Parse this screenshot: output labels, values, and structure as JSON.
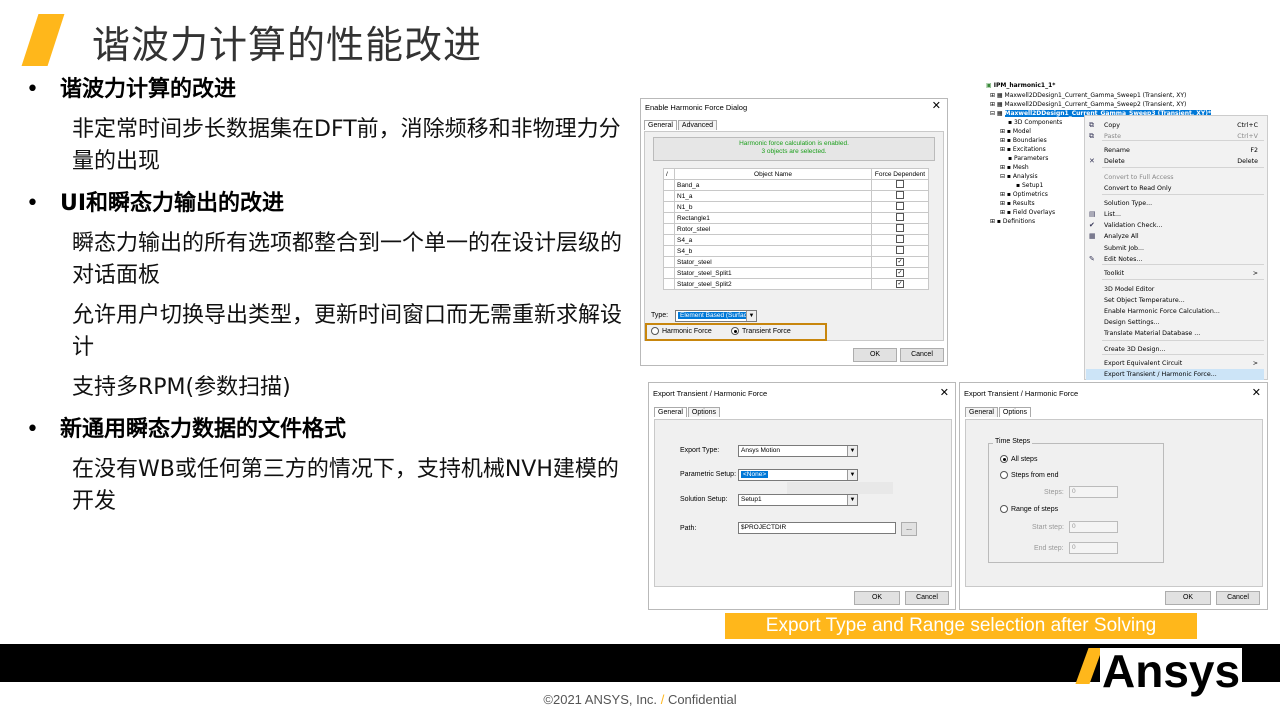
{
  "slide": {
    "title": "谐波力计算的性能改进",
    "bullets": [
      {
        "text": "谐波力计算的改进",
        "subs": [
          "非定常时间步长数据集在DFT前，消除频移和非物理力分量的出现"
        ]
      },
      {
        "text": "UI和瞬态力输出的改进",
        "subs": [
          "瞬态力输出的所有选项都整合到一个单一的在设计层级的对话面板",
          "允许用户切换导出类型，更新时间窗口而无需重新求解设计",
          "支持多RPM(参数扫描)"
        ]
      },
      {
        "text": "新通用瞬态力数据的文件格式",
        "subs": [
          "在没有WB或任何第三方的情况下，支持机械NVH建模的开发"
        ]
      }
    ],
    "caption": "Export Type and Range selection after Solving",
    "logo": "Ansys",
    "footer": {
      "copyright": "©2021 ANSYS, Inc.",
      "separator": "/",
      "confidential": "Confidential"
    }
  },
  "harmonic_dialog": {
    "title": "Enable Harmonic Force Dialog",
    "close": "✕",
    "tabs": [
      "General",
      "Advanced"
    ],
    "status_line1": "Harmonic force calculation is enabled.",
    "status_line2": "3 objects are selected.",
    "col_sort": "/",
    "col_object": "Object Name",
    "col_force": "Force Dependent",
    "rows": [
      {
        "name": "Band_a",
        "checked": false
      },
      {
        "name": "N1_a",
        "checked": false
      },
      {
        "name": "N1_b",
        "checked": false
      },
      {
        "name": "Rectangle1",
        "checked": false
      },
      {
        "name": "Rotor_steel",
        "checked": false
      },
      {
        "name": "S4_a",
        "checked": false
      },
      {
        "name": "S4_b",
        "checked": false
      },
      {
        "name": "Stator_steel",
        "checked": true
      },
      {
        "name": "Stator_steel_Split1",
        "checked": true
      },
      {
        "name": "Stator_steel_Split2",
        "checked": true
      }
    ],
    "type_label": "Type:",
    "type_value": "Element Based (Surface)",
    "radio_harmonic": "Harmonic Force",
    "radio_transient": "Transient Force",
    "ok": "OK",
    "cancel": "Cancel"
  },
  "project_tree": {
    "root": "IPM_harmonic1_1*",
    "designs": [
      "Maxwell2DDesign1_Current_Gamma_Sweep1 (Transient, XY)",
      "Maxwell2DDesign1_Current_Gamma_Sweep2 (Transient, XY)",
      "Maxwell2DDesign1_Current_Gamma_Sweep3 (Transient, XY)*"
    ],
    "items": [
      "3D Components",
      "Model",
      "Boundaries",
      "Excitations",
      "Parameters",
      "Mesh",
      "Analysis",
      "Setup1",
      "Optimetrics",
      "Results",
      "Field Overlays",
      "Definitions"
    ]
  },
  "context_menu": {
    "items": [
      {
        "label": "Copy",
        "shortcut": "Ctrl+C"
      },
      {
        "label": "Paste",
        "shortcut": "Ctrl+V"
      },
      {
        "label": "Rename",
        "shortcut": "F2"
      },
      {
        "label": "Delete",
        "shortcut": "Delete"
      },
      {
        "label": "Convert to Full Access",
        "shortcut": ""
      },
      {
        "label": "Convert to Read Only",
        "shortcut": ""
      },
      {
        "label": "Solution Type...",
        "shortcut": ""
      },
      {
        "label": "List...",
        "shortcut": ""
      },
      {
        "label": "Validation Check...",
        "shortcut": ""
      },
      {
        "label": "Analyze All",
        "shortcut": ""
      },
      {
        "label": "Submit Job...",
        "shortcut": ""
      },
      {
        "label": "Edit Notes...",
        "shortcut": ""
      },
      {
        "label": "Toolkit",
        "shortcut": ">"
      },
      {
        "label": "3D Model Editor",
        "shortcut": ""
      },
      {
        "label": "Set Object Temperature...",
        "shortcut": ""
      },
      {
        "label": "Enable Harmonic Force Calculation...",
        "shortcut": ""
      },
      {
        "label": "Design Settings...",
        "shortcut": ""
      },
      {
        "label": "Translate Material Database ...",
        "shortcut": ""
      },
      {
        "label": "Create 3D Design...",
        "shortcut": ""
      },
      {
        "label": "Export Equivalent Circuit",
        "shortcut": ">"
      },
      {
        "label": "Export Transient / Harmonic Force...",
        "shortcut": ""
      }
    ]
  },
  "export_general": {
    "title": "Export Transient / Harmonic Force",
    "close": "✕",
    "tabs": [
      "General",
      "Options"
    ],
    "export_type_label": "Export Type:",
    "export_type_value": "Ansys Motion",
    "parametric_label": "Parametric Setup:",
    "parametric_value": "<None>",
    "solution_label": "Solution Setup:",
    "solution_value": "Setup1",
    "path_label": "Path:",
    "path_value": "$PROJECTDIR",
    "browse": "...",
    "ok": "OK",
    "cancel": "Cancel"
  },
  "export_options": {
    "title": "Export Transient / Harmonic Force",
    "close": "✕",
    "tabs": [
      "General",
      "Options"
    ],
    "group": "Time Steps",
    "all_steps": "All steps",
    "steps_from_end": "Steps from end",
    "steps_label": "Steps:",
    "steps_value": "0",
    "range": "Range of steps",
    "start_label": "Start step:",
    "start_value": "0",
    "end_label": "End step:",
    "end_value": "0",
    "ok": "OK",
    "cancel": "Cancel"
  },
  "colors": {
    "accent": "#ffb71b",
    "selection": "#0078d7",
    "highlight_box": "#c8860d"
  }
}
